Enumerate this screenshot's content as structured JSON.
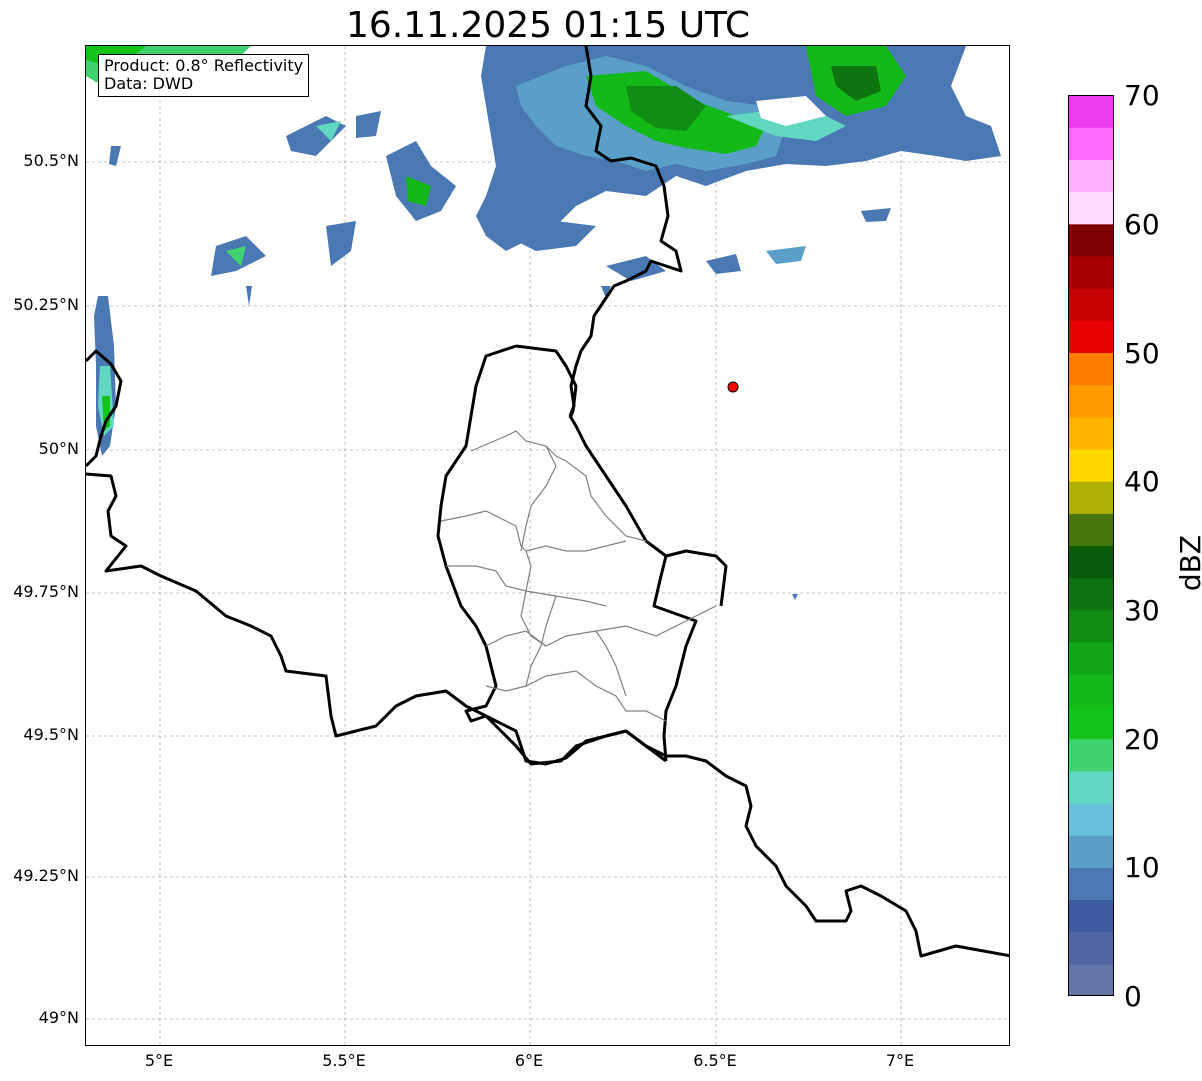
{
  "title": "16.11.2025 01:15 UTC",
  "info": {
    "product": "Product: 0.8° Reflectivity",
    "data": "Data: DWD"
  },
  "lat_labels": [
    "50.5°N",
    "50.25°N",
    "50°N",
    "49.75°N",
    "49.5°N",
    "49.25°N",
    "49°N"
  ],
  "lon_labels": [
    "5°E",
    "5.5°E",
    "6°E",
    "6.5°E",
    "7°E"
  ],
  "colorbar": {
    "unit": "dBZ",
    "ticks": [
      "0",
      "10",
      "20",
      "30",
      "40",
      "50",
      "60",
      "70"
    ],
    "colors": [
      "#6475a7",
      "#5166a2",
      "#3f5ba1",
      "#4978b2",
      "#599fc8",
      "#66c2dc",
      "#61d7c2",
      "#3ed36f",
      "#12c41a",
      "#12b917",
      "#12a617",
      "#108c15",
      "#0d7410",
      "#0a5c0c",
      "#47760a",
      "#aeb005",
      "#ffd700",
      "#ffb400",
      "#ff9a00",
      "#ff7e00",
      "#e80000",
      "#c80000",
      "#a60000",
      "#7c0000",
      "#ffdcff",
      "#ffb0ff",
      "#ff6aff",
      "#e93cee"
    ]
  },
  "marker": {
    "lat": 50.11,
    "lon": 6.55,
    "color": "#ff0000"
  }
}
